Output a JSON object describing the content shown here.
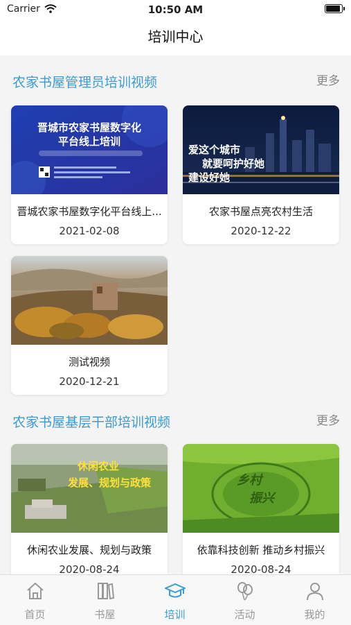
{
  "status": {
    "carrier": "Carrier",
    "time": "10:50 AM"
  },
  "nav": {
    "title": "培训中心"
  },
  "sections": [
    {
      "title": "农家书屋管理员培训视频",
      "more": "更多",
      "items": [
        {
          "title": "晋城农家书屋数字化平台线上...",
          "date": "2021-02-08",
          "thumb_text": [
            "晋城市农家书屋数字化",
            "平台线上培训"
          ]
        },
        {
          "title": "农家书屋点亮农村生活",
          "date": "2020-12-22",
          "thumb_text": [
            "爱这个城市",
            "就要呵护好她",
            "建设好她"
          ]
        },
        {
          "title": "测试视频",
          "date": "2020-12-21"
        }
      ]
    },
    {
      "title": "农家书屋基层干部培训视频",
      "more": "更多",
      "items": [
        {
          "title": "休闲农业发展、规划与政策",
          "date": "2020-08-24",
          "thumb_text": [
            "休闲农业",
            "发展、规划与政策"
          ]
        },
        {
          "title": "依靠科技创新 推动乡村振兴",
          "date": "2020-08-24",
          "thumb_text": [
            "乡村",
            "振兴"
          ]
        }
      ]
    }
  ],
  "tabs": [
    {
      "label": "首页",
      "icon": "home-icon"
    },
    {
      "label": "书屋",
      "icon": "books-icon"
    },
    {
      "label": "培训",
      "icon": "graduation-cap-icon",
      "active": true
    },
    {
      "label": "活动",
      "icon": "balloons-icon"
    },
    {
      "label": "我的",
      "icon": "user-icon"
    }
  ],
  "colors": {
    "accent": "#3a9bd8",
    "inactive": "#999999"
  }
}
